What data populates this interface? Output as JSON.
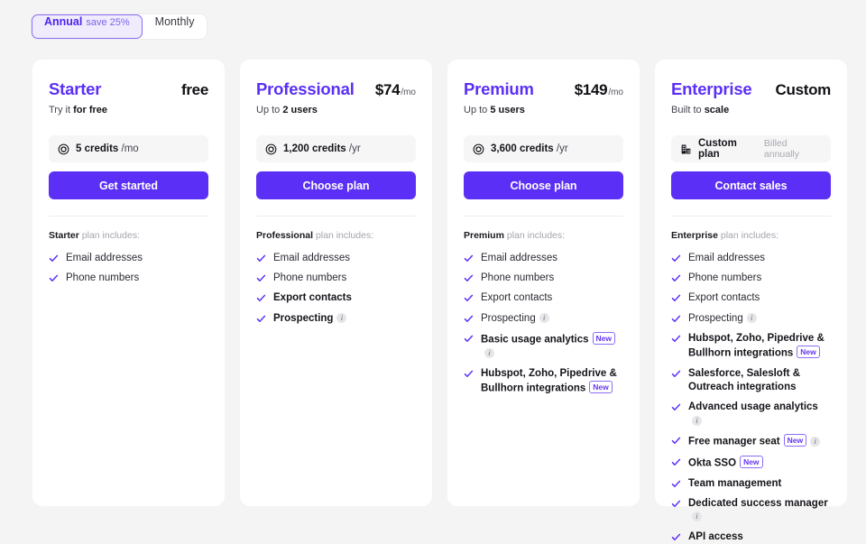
{
  "billing_toggle": {
    "options": [
      {
        "label": "Annual",
        "sub": "save 25%",
        "active": true
      },
      {
        "label": "Monthly",
        "sub": "",
        "active": false
      }
    ]
  },
  "plans": [
    {
      "name": "Starter",
      "price": "free",
      "price_per": "",
      "tagline_prefix": "Try it ",
      "tagline_bold": "for free",
      "credits_icon": "credit-coin-icon",
      "credits_amount": "5 credits",
      "credits_unit": "/mo",
      "credits_note": "",
      "cta": "Get started",
      "includes_plan": "Starter",
      "includes_suffix": " plan includes:",
      "features": [
        {
          "text": "Email addresses",
          "bold": false,
          "new": false,
          "info": false
        },
        {
          "text": "Phone numbers",
          "bold": false,
          "new": false,
          "info": false
        }
      ]
    },
    {
      "name": "Professional",
      "price": "$74",
      "price_per": "/mo",
      "tagline_prefix": "Up to ",
      "tagline_bold": "2 users",
      "credits_icon": "credit-coin-icon",
      "credits_amount": "1,200 credits",
      "credits_unit": "/yr",
      "credits_note": "",
      "cta": "Choose plan",
      "includes_plan": "Professional",
      "includes_suffix": " plan includes:",
      "features": [
        {
          "text": "Email addresses",
          "bold": false,
          "new": false,
          "info": false
        },
        {
          "text": "Phone numbers",
          "bold": false,
          "new": false,
          "info": false
        },
        {
          "text": "Export contacts",
          "bold": true,
          "new": false,
          "info": false
        },
        {
          "text": "Prospecting",
          "bold": true,
          "new": false,
          "info": true
        }
      ]
    },
    {
      "name": "Premium",
      "price": "$149",
      "price_per": "/mo",
      "tagline_prefix": "Up to ",
      "tagline_bold": "5 users",
      "credits_icon": "credit-coin-icon",
      "credits_amount": "3,600 credits",
      "credits_unit": "/yr",
      "credits_note": "",
      "cta": "Choose plan",
      "includes_plan": "Premium",
      "includes_suffix": " plan includes:",
      "features": [
        {
          "text": "Email addresses",
          "bold": false,
          "new": false,
          "info": false
        },
        {
          "text": "Phone numbers",
          "bold": false,
          "new": false,
          "info": false
        },
        {
          "text": "Export contacts",
          "bold": false,
          "new": false,
          "info": false
        },
        {
          "text": "Prospecting",
          "bold": false,
          "new": false,
          "info": true
        },
        {
          "text": "Basic usage analytics",
          "bold": true,
          "new": true,
          "info": true
        },
        {
          "text": "Hubspot, Zoho, Pipedrive & Bullhorn integrations",
          "bold": true,
          "new": true,
          "info": false
        }
      ]
    },
    {
      "name": "Enterprise",
      "price": "Custom",
      "price_per": "",
      "tagline_prefix": "Built to ",
      "tagline_bold": "scale",
      "credits_icon": "building-icon",
      "credits_amount": "Custom plan",
      "credits_unit": "",
      "credits_note": "Billed annually",
      "cta": "Contact sales",
      "includes_plan": "Enterprise",
      "includes_suffix": " plan includes:",
      "features": [
        {
          "text": "Email addresses",
          "bold": false,
          "new": false,
          "info": false
        },
        {
          "text": "Phone numbers",
          "bold": false,
          "new": false,
          "info": false
        },
        {
          "text": "Export contacts",
          "bold": false,
          "new": false,
          "info": false
        },
        {
          "text": "Prospecting",
          "bold": false,
          "new": false,
          "info": true
        },
        {
          "text": "Hubspot, Zoho, Pipedrive & Bullhorn integrations",
          "bold": true,
          "new": true,
          "info": false
        },
        {
          "text": "Salesforce, Salesloft & Outreach integrations",
          "bold": true,
          "new": false,
          "info": false
        },
        {
          "text": "Advanced usage analytics",
          "bold": true,
          "new": false,
          "info": true
        },
        {
          "text": "Free manager seat",
          "bold": true,
          "new": true,
          "info": true
        },
        {
          "text": "Okta SSO",
          "bold": true,
          "new": true,
          "info": false
        },
        {
          "text": "Team management",
          "bold": true,
          "new": false,
          "info": false
        },
        {
          "text": "Dedicated success manager",
          "bold": true,
          "new": false,
          "info": true
        },
        {
          "text": "API access",
          "bold": true,
          "new": false,
          "info": false
        }
      ]
    }
  ],
  "badges": {
    "new_label": "New",
    "info_label": "i"
  },
  "colors": {
    "accent": "#5b2ff5",
    "accent_light": "#f0ecfe",
    "page_bg": "#f4f4f4",
    "card_bg": "#ffffff",
    "pill_bg": "#f6f6f6"
  }
}
